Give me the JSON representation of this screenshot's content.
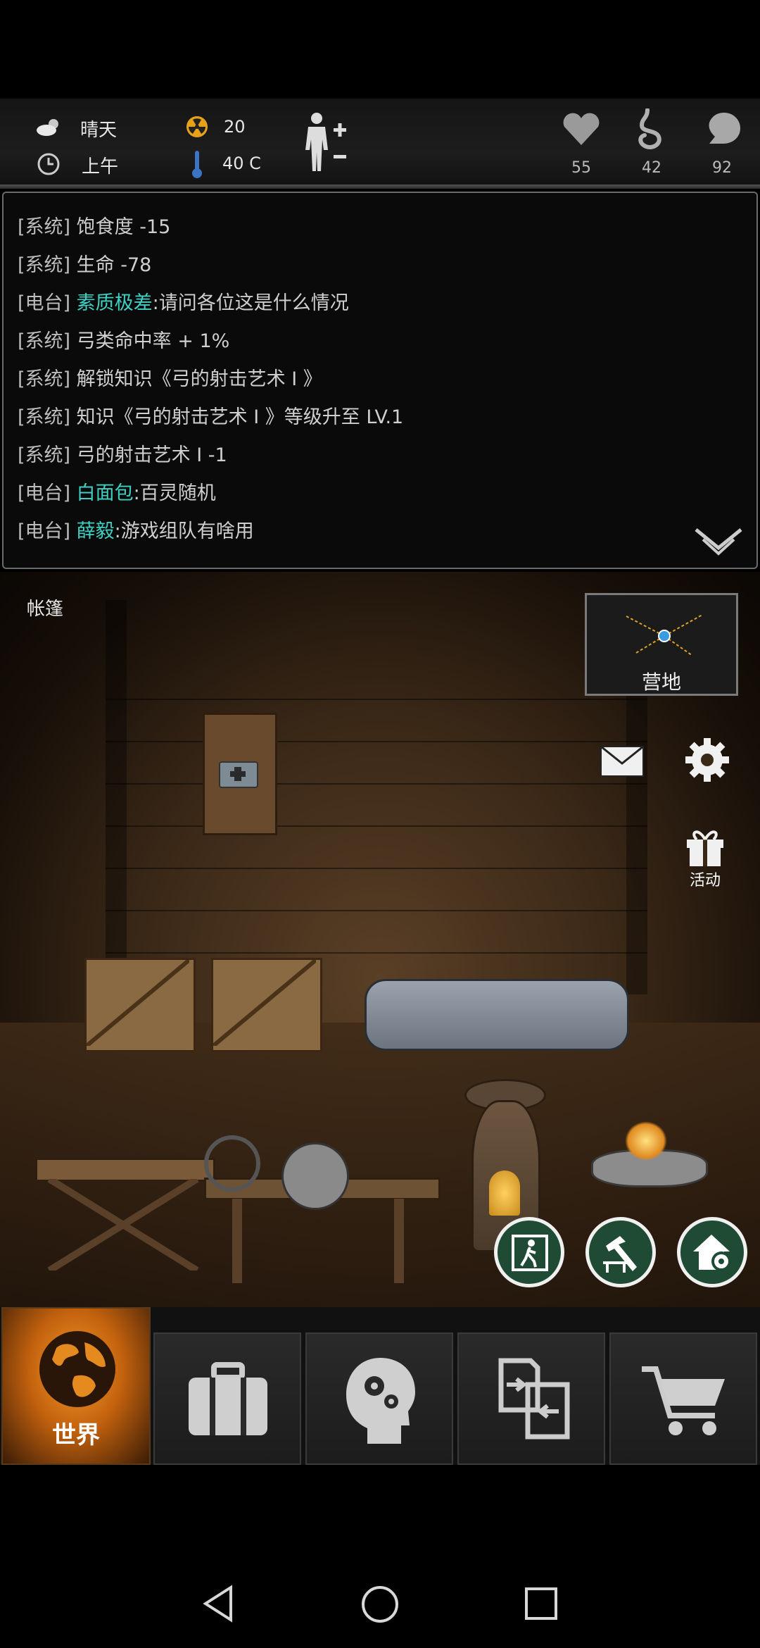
{
  "hud": {
    "weather": "晴天",
    "time_of_day": "上午",
    "radiation": "20",
    "temperature": "40 C",
    "health": "55",
    "hunger": "42",
    "thirst": "92"
  },
  "log": {
    "lines": [
      {
        "tag": "[系统]",
        "name": "",
        "text": "饱食度 -15"
      },
      {
        "tag": "[系统]",
        "name": "",
        "text": "生命 -78"
      },
      {
        "tag": "[电台]",
        "name": "素质极差",
        "text": ":请问各位这是什么情况"
      },
      {
        "tag": "[系统]",
        "name": "",
        "text": "弓类命中率 + 1%"
      },
      {
        "tag": "[系统]",
        "name": "",
        "text": "解锁知识《弓的射击艺术 I 》"
      },
      {
        "tag": "[系统]",
        "name": "",
        "text": "知识《弓的射击艺术 I 》等级升至 LV.1"
      },
      {
        "tag": "[系统]",
        "name": "",
        "text": "弓的射击艺术 I -1"
      },
      {
        "tag": "[电台]",
        "name": "白面包",
        "text": ":百灵随机"
      },
      {
        "tag": "[电台]",
        "name": "薛毅",
        "text": ":游戏组队有啥用"
      }
    ]
  },
  "scene": {
    "location": "帐篷",
    "map_label": "营地",
    "activity_label": "活动"
  },
  "nav": {
    "world_label": "世界"
  },
  "colors": {
    "accent_orange": "#e07a12",
    "name_cyan": "#3fd0c4"
  }
}
